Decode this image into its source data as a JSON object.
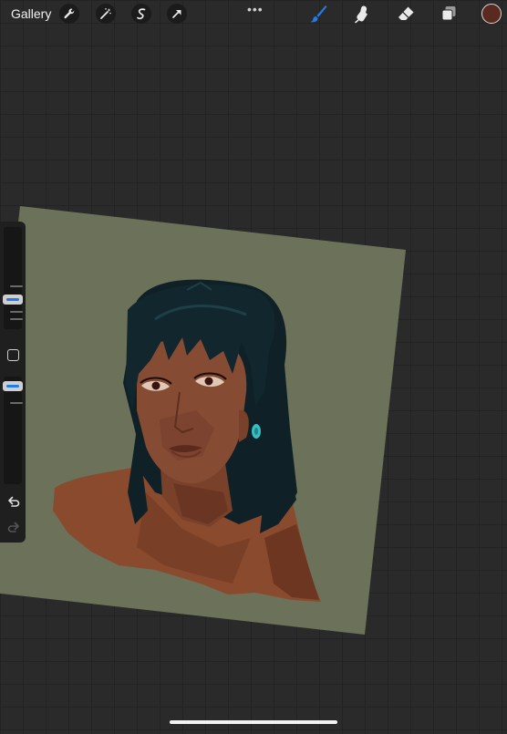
{
  "topbar": {
    "gallery_label": "Gallery",
    "left_tools": [
      {
        "icon": "wrench-icon",
        "name": "actions"
      },
      {
        "icon": "magic-wand-icon",
        "name": "adjustments"
      },
      {
        "icon": "selection-icon",
        "name": "selection"
      },
      {
        "icon": "transform-arrow-icon",
        "name": "transform"
      }
    ],
    "more_label": "•••",
    "right_tools": [
      {
        "icon": "brush-icon",
        "name": "paint",
        "active": true
      },
      {
        "icon": "smudge-icon",
        "name": "smudge",
        "active": false
      },
      {
        "icon": "eraser-icon",
        "name": "erase",
        "active": false
      },
      {
        "icon": "layers-icon",
        "name": "layers",
        "active": false
      }
    ],
    "current_color": "#5a2a20"
  },
  "sidebar": {
    "brush_size_level": 0.25,
    "opacity_level": 0.05
  },
  "colors": {
    "accent": "#1e7cf0",
    "canvas_bg": "#6b7259",
    "skin": "#8a4a2e",
    "hair": "#0f2126",
    "earring": "#37c0c4"
  }
}
